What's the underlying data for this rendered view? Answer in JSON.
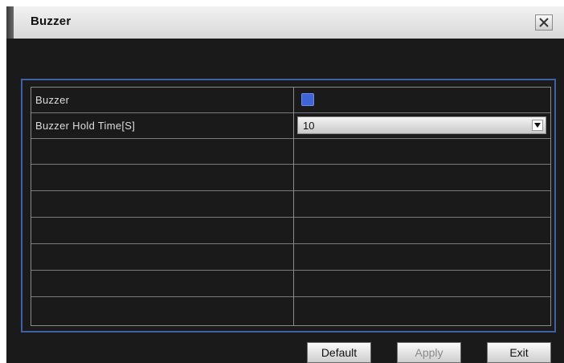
{
  "window": {
    "title": "Buzzer"
  },
  "settings": {
    "rows": [
      {
        "label": "Buzzer",
        "control": "checkbox",
        "checked": true
      },
      {
        "label": "Buzzer Hold Time[S]",
        "control": "select",
        "value": "10"
      }
    ]
  },
  "buttons": {
    "default_label": "Default",
    "apply_label": "Apply",
    "exit_label": "Exit"
  },
  "colors": {
    "panel_border": "#3f5fa6",
    "checkbox_fill": "#3f64d6",
    "background": "#1a1a1a"
  },
  "icons": {
    "close": "close-icon",
    "dropdown": "chevron-down-icon"
  }
}
